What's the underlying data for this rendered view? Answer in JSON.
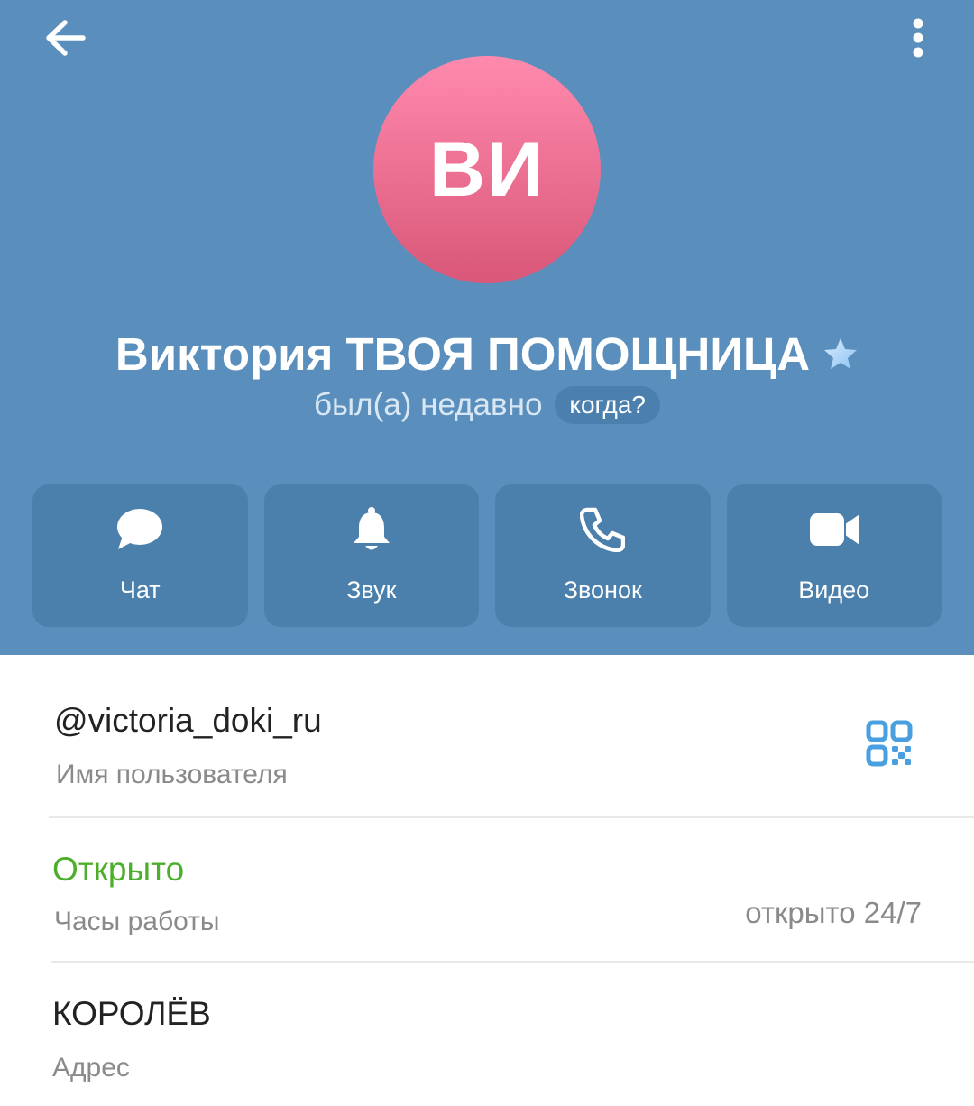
{
  "profile": {
    "initials": "ВИ",
    "name": "Виктория ТВОЯ ПОМОЩНИЦА",
    "status": "был(а) недавно",
    "when_label": "когда?",
    "avatar_colors": [
      "#ff8aae",
      "#d95778"
    ]
  },
  "actions": [
    {
      "label": "Чат",
      "icon": "chat-bubble-icon"
    },
    {
      "label": "Звук",
      "icon": "bell-icon"
    },
    {
      "label": "Звонок",
      "icon": "phone-icon"
    },
    {
      "label": "Видео",
      "icon": "video-camera-icon"
    }
  ],
  "info": {
    "username": {
      "value": "@victoria_doki_ru",
      "label": "Имя пользователя",
      "icon": "qr-code-icon"
    },
    "hours": {
      "value": "Открыто",
      "label": "Часы работы",
      "detail": "открыто 24/7",
      "value_color": "#4caf2a"
    },
    "address": {
      "value": "КОРОЛЁВ",
      "label": "Адрес"
    }
  },
  "colors": {
    "header_bg": "#5a8fbd",
    "action_bg": "#4b80ad",
    "accent": "#4a9fe0"
  }
}
